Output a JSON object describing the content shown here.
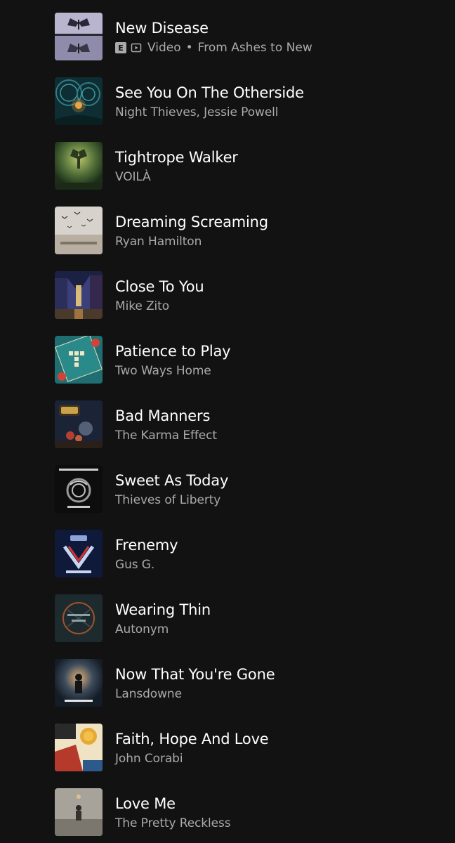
{
  "colors": {
    "background": "#121212",
    "title": "#ffffff",
    "subtitle": "#aaaaaa"
  },
  "tracks": [
    {
      "title": "New Disease",
      "explicit": "E",
      "type_label": "Video",
      "separator": "•",
      "subtitle": "From Ashes to New",
      "art": "moth-art"
    },
    {
      "title": "See You On The Otherside",
      "subtitle": "Night Thieves, Jessie Powell",
      "art": "teal-swirl-art"
    },
    {
      "title": "Tightrope Walker",
      "subtitle": "VOILÀ",
      "art": "green-figure-art"
    },
    {
      "title": "Dreaming Screaming",
      "subtitle": "Ryan Hamilton",
      "art": "birds-sky-art"
    },
    {
      "title": "Close To You",
      "subtitle": "Mike Zito",
      "art": "night-street-art"
    },
    {
      "title": "Patience to Play",
      "subtitle": "Two Ways Home",
      "art": "scrabble-board-art"
    },
    {
      "title": "Bad Manners",
      "subtitle": "The Karma Effect",
      "art": "still-life-art"
    },
    {
      "title": "Sweet As Today",
      "subtitle": "Thieves of Liberty",
      "art": "dragon-art"
    },
    {
      "title": "Frenemy",
      "subtitle": "Gus G.",
      "art": "gus-g-logo-art"
    },
    {
      "title": "Wearing Thin",
      "subtitle": "Autonym",
      "art": "wearing-thin-art"
    },
    {
      "title": "Now That You're Gone",
      "subtitle": "Lansdowne",
      "art": "silhouette-art"
    },
    {
      "title": "Faith, Hope And Love",
      "subtitle": "John Corabi",
      "art": "tarot-sun-art"
    },
    {
      "title": "Love Me",
      "subtitle": "The Pretty Reckless",
      "art": "gray-room-art"
    }
  ]
}
